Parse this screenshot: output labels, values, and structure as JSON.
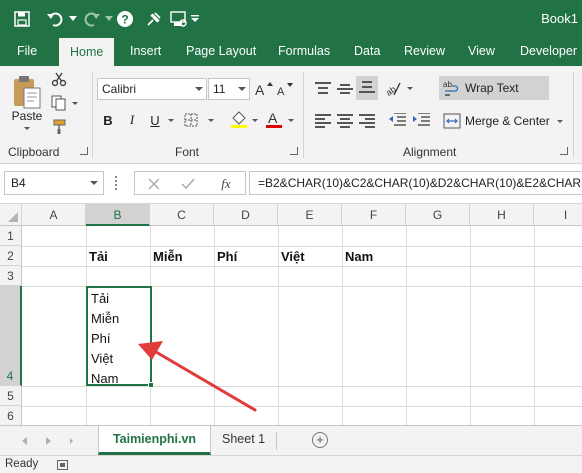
{
  "window": {
    "title": "Book1"
  },
  "ribbon_tabs": [
    "File",
    "Home",
    "Insert",
    "Page Layout",
    "Formulas",
    "Data",
    "Review",
    "View",
    "Developer"
  ],
  "ribbon": {
    "clipboard": {
      "paste_label": "Paste",
      "group_label": "Clipboard"
    },
    "font": {
      "font_name": "Calibri",
      "font_size": "11",
      "bold": "B",
      "italic": "I",
      "underline": "U",
      "group_label": "Font"
    },
    "alignment": {
      "wrap_text": "Wrap Text",
      "merge_center": "Merge & Center",
      "group_label": "Alignment"
    },
    "accent_color": "#217346",
    "font_color_swatch": "#e00000",
    "fill_color_swatch": "#ffff00"
  },
  "formula_bar": {
    "name_box": "B4",
    "fx_label": "fx",
    "formula": "=B2&CHAR(10)&C2&CHAR(10)&D2&CHAR(10)&E2&CHAR(10)&F2"
  },
  "grid": {
    "columns": [
      "A",
      "B",
      "C",
      "D",
      "E",
      "F",
      "G",
      "H",
      "I"
    ],
    "rows": [
      "1",
      "2",
      "3",
      "4",
      "5",
      "6"
    ],
    "row2": {
      "B": "Tải",
      "C": "Miễn",
      "D": "Phí",
      "E": "Việt",
      "F": "Nam"
    },
    "b4_lines": [
      "Tải",
      "Miễn",
      "Phí",
      "Việt",
      "Nam"
    ]
  },
  "sheets": {
    "tabs": [
      "Taimienphi.vn",
      "Sheet 1"
    ],
    "add": "+"
  },
  "status": "Ready"
}
